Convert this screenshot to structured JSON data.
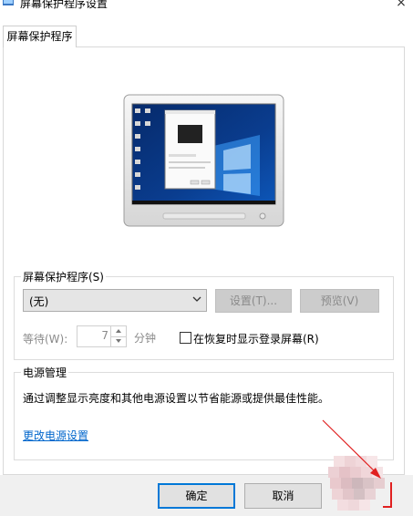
{
  "window": {
    "title": "屏幕保护程序设置",
    "close_glyph": "×"
  },
  "tab": {
    "label": "屏幕保护程序"
  },
  "screensaver_group": {
    "label": "屏幕保护程序(S)",
    "selected_value": "(无)",
    "settings_button": "设置(T)...",
    "preview_button": "预览(V)",
    "wait_label": "等待(W):",
    "wait_value": "7",
    "wait_unit": "分钟",
    "resume_checkbox_label": "在恢复时显示登录屏幕(R)",
    "resume_checked": false
  },
  "power_group": {
    "label": "电源管理",
    "description": "通过调整显示亮度和其他电源设置以节省能源或提供最佳性能。",
    "link": "更改电源设置"
  },
  "footer": {
    "ok_button": "确定",
    "cancel_button": "取消"
  },
  "colors": {
    "accent": "#0078d7",
    "link": "#0066cc",
    "annotation": "#e02020",
    "desktop": "#0a3d8f"
  },
  "icons": [
    "app-icon",
    "close-icon",
    "chevron-down-icon",
    "spin-up-icon",
    "spin-down-icon",
    "monitor-preview"
  ]
}
